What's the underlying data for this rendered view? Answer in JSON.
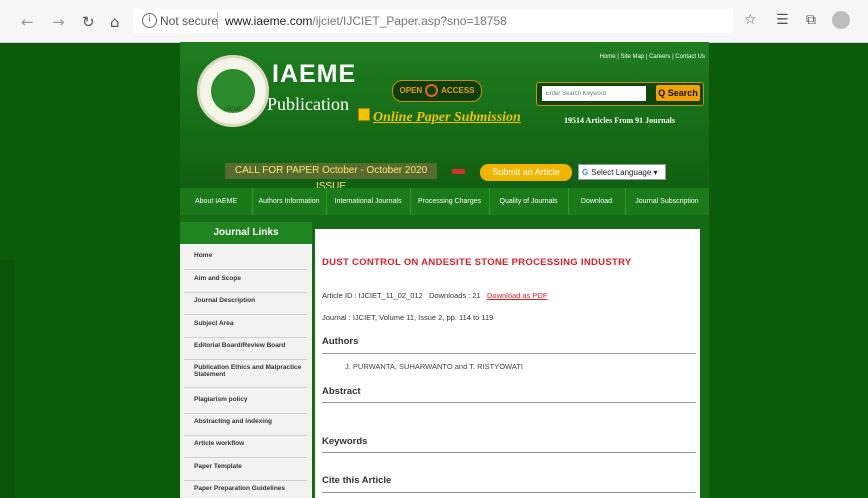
{
  "browser": {
    "not_secure": "Not secure",
    "url_host": "www.iaeme.com",
    "url_path": "/ijciet/IJCIET_Paper.asp?sno=18758"
  },
  "header": {
    "brand_name": "IAEME",
    "brand_sub": "Publication",
    "logo_text": "IAEME",
    "open_access_left": "OPEN",
    "open_access_right": "ACCESS",
    "online_submission": "Online Paper Submission",
    "top_links": "Home | Site Map | Careers | Contact Us",
    "search_placeholder": "Enter Search Keyword",
    "search_button": "Q Search",
    "articles_count": "19514 Articles From 91 Journals",
    "call_for_paper": "CALL FOR PAPER October - October 2020 ISSUE",
    "submit_article": "Submit an Article",
    "select_language": "Select Language"
  },
  "menu": [
    "About IAEME",
    "Authors Information",
    "International Journals",
    "Processing Charges",
    "Quality of Journals",
    "Download",
    "Journal Subscription"
  ],
  "sidebar": {
    "title": "Journal Links",
    "items": [
      "Home",
      "Aim and Scope",
      "Journal Description",
      "Subject Area",
      "Editorial Board/Review Board",
      "Publication Ethics and Malpractice Statement",
      "Plagiarism policy",
      "Abstracting and indexing",
      "Article workflow",
      "Paper Template",
      "Paper Preparation Guidelines"
    ]
  },
  "article": {
    "title": "DUST CONTROL ON ANDESITE STONE PROCESSING INDUSTRY",
    "article_id": "Article ID : IJCIET_11_02_012",
    "downloads": "Downloads : 21",
    "download_link": "Download as PDF",
    "journal_line": "Journal : IJCIET,  Volume 11,  Issue 2,  pp. 114 to 119",
    "authors_heading": "Authors",
    "authors": "J. PURWANTA, SUHARWANTO and T. RISTYOWATI",
    "abstract_heading": "Abstract",
    "keywords_heading": "Keywords",
    "cite_heading": "Cite this Article"
  },
  "colors": {
    "page_bg": "#0a5c0a",
    "header_green": "#156c15",
    "accent_orange": "#f3a200",
    "title_red": "#e11d24"
  }
}
